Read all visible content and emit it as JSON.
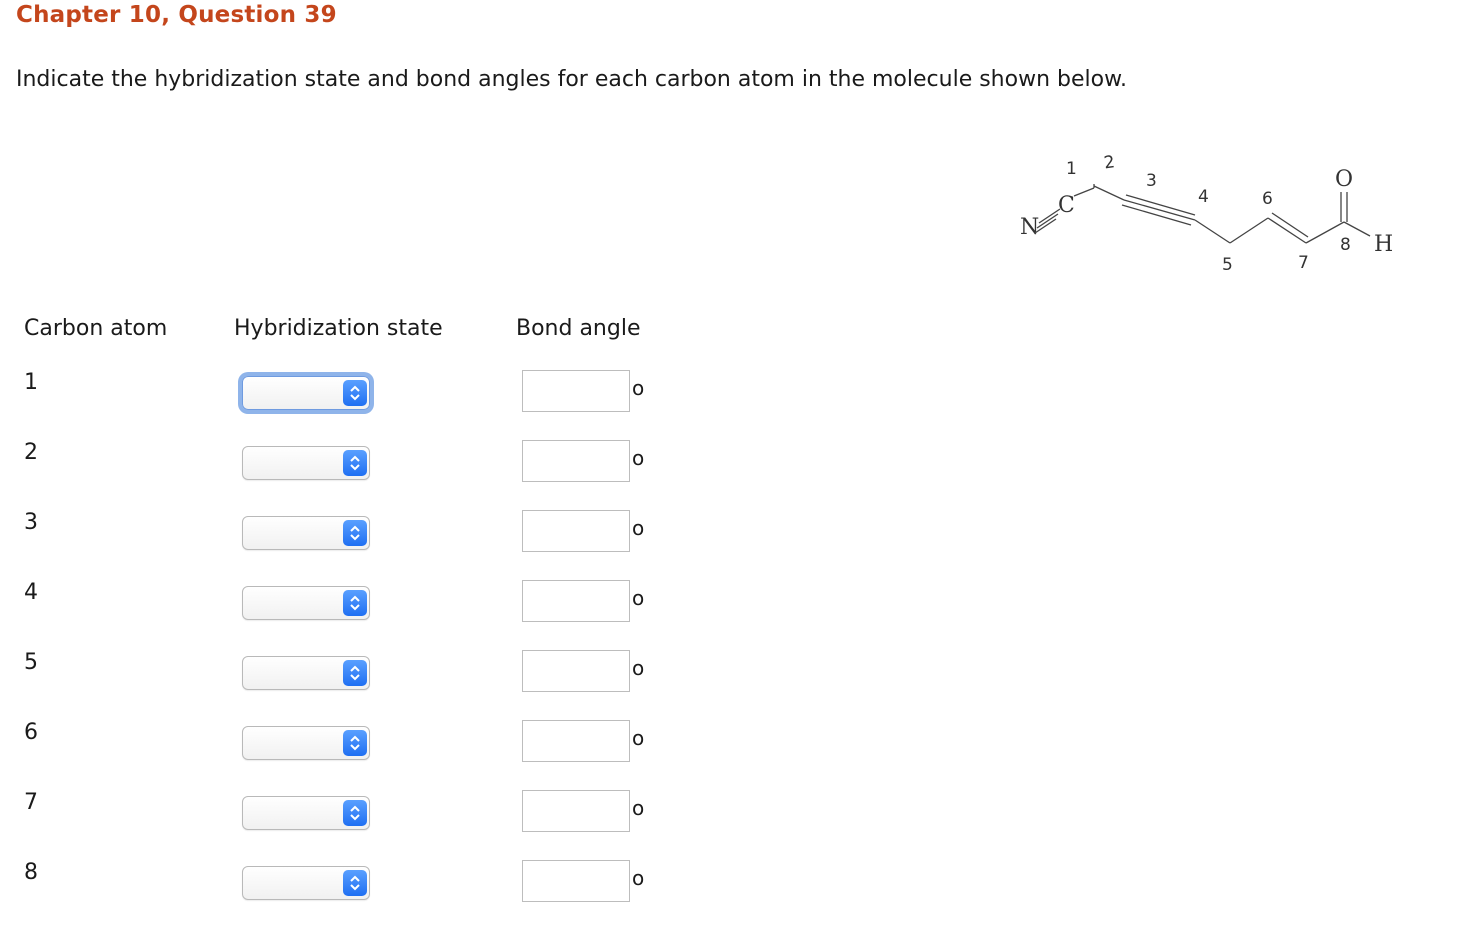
{
  "header": {
    "title": "Chapter 10, Question 39",
    "prompt": "Indicate the hybridization state and bond angles for each carbon atom in the molecule shown below."
  },
  "molecule": {
    "atom_numbers": [
      "1",
      "2",
      "3",
      "4",
      "5",
      "6",
      "7",
      "8"
    ],
    "N": "N",
    "C": "C",
    "O": "O",
    "H": "H"
  },
  "table": {
    "columns": [
      "Carbon atom",
      "Hybridization state",
      "Bond angle"
    ],
    "degree_symbol": "o",
    "rows": [
      {
        "atom": "1",
        "hybridization": "",
        "angle": ""
      },
      {
        "atom": "2",
        "hybridization": "",
        "angle": ""
      },
      {
        "atom": "3",
        "hybridization": "",
        "angle": ""
      },
      {
        "atom": "4",
        "hybridization": "",
        "angle": ""
      },
      {
        "atom": "5",
        "hybridization": "",
        "angle": ""
      },
      {
        "atom": "6",
        "hybridization": "",
        "angle": ""
      },
      {
        "atom": "7",
        "hybridization": "",
        "angle": ""
      },
      {
        "atom": "8",
        "hybridization": "",
        "angle": ""
      }
    ]
  },
  "colors": {
    "title": "#c4461c",
    "select_arrow": "#1f6ff2",
    "focus_ring": "#8fb4ea"
  }
}
